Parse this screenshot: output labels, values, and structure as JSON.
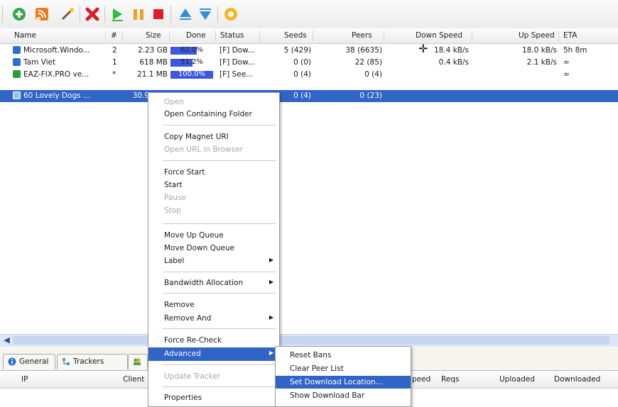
{
  "toolbar": {
    "icons": [
      "add-torrent-icon",
      "create-torrent-icon",
      "add-url-icon",
      "remove-icon",
      "start-icon",
      "pause-icon",
      "stop-icon",
      "queue-up-icon",
      "queue-down-icon",
      "preferences-icon"
    ]
  },
  "columns": {
    "name": "Name",
    "num": "#",
    "size": "Size",
    "done": "Done",
    "status": "Status",
    "seeds": "Seeds",
    "peers": "Peers",
    "down_speed": "Down Speed",
    "up_speed": "Up Speed",
    "eta": "ETA"
  },
  "torrents": [
    {
      "name": "Microsoft.Windo...",
      "num": "2",
      "size": "2.23 GB",
      "done": "62.0%",
      "progress": 0.62,
      "status": "[F] Dow...",
      "seeds": "5 (429)",
      "peers": "38 (6635)",
      "down": "18.4 kB/s",
      "up": "18.0 kB/s",
      "eta": "5h 8m",
      "color": "#2a6fd6"
    },
    {
      "name": "Tam Viet",
      "num": "1",
      "size": "618 MB",
      "done": "51.2%",
      "progress": 0.512,
      "status": "[F] Dow...",
      "seeds": "0 (0)",
      "peers": "22 (85)",
      "down": "0.4 kB/s",
      "up": "2.1 kB/s",
      "eta": "∞",
      "color": "#2a6fd6"
    },
    {
      "name": "EAZ-FIX.PRO ve...",
      "num": "*",
      "size": "21.1 MB",
      "done": "100.0%",
      "progress": 1.0,
      "status": "[F] See...",
      "seeds": "0 (4)",
      "peers": "0 (4)",
      "down": "",
      "up": "",
      "eta": "∞",
      "color": "#2a9d3a"
    },
    {
      "name": "60 Lovely Dogs ...",
      "num": "",
      "size": "30.9",
      "done": "",
      "progress": 0,
      "status": "",
      "seeds": "0 (4)",
      "peers": "0 (23)",
      "down": "",
      "up": "",
      "eta": "",
      "color": "#4e8bd8"
    }
  ],
  "context_menu": {
    "items": [
      {
        "label": "Open",
        "disabled": true
      },
      {
        "label": "Open Containing Folder",
        "disabled": false
      },
      {
        "label": "Copy Magnet URI",
        "disabled": false
      },
      {
        "label": "Open URL in Browser",
        "disabled": true
      },
      {
        "label": "Force Start",
        "disabled": false
      },
      {
        "label": "Start",
        "disabled": false
      },
      {
        "label": "Pause",
        "disabled": true
      },
      {
        "label": "Stop",
        "disabled": true
      },
      {
        "label": "Move Up Queue",
        "disabled": false
      },
      {
        "label": "Move Down Queue",
        "disabled": false
      },
      {
        "label": "Label",
        "disabled": false
      },
      {
        "label": "Bandwidth Allocation",
        "disabled": false
      },
      {
        "label": "Remove",
        "disabled": false
      },
      {
        "label": "Remove And",
        "disabled": false
      },
      {
        "label": "Force Re-Check",
        "disabled": false
      },
      {
        "label": "Advanced",
        "disabled": false
      },
      {
        "label": "Update Tracker",
        "disabled": true
      },
      {
        "label": "Properties",
        "disabled": false
      }
    ]
  },
  "advanced_submenu": {
    "items": [
      {
        "label": "Reset Bans"
      },
      {
        "label": "Clear Peer List"
      },
      {
        "label": "Set Download Location..."
      },
      {
        "label": "Show Download Bar"
      }
    ]
  },
  "tabs": [
    {
      "label": "General",
      "icon": "info-icon"
    },
    {
      "label": "Trackers",
      "icon": "trackers-icon"
    }
  ],
  "peers_columns": {
    "ip": "IP",
    "client": "Client",
    "speed": "peed",
    "reqs": "Reqs",
    "uploaded": "Uploaded",
    "downloaded": "Downloaded"
  }
}
